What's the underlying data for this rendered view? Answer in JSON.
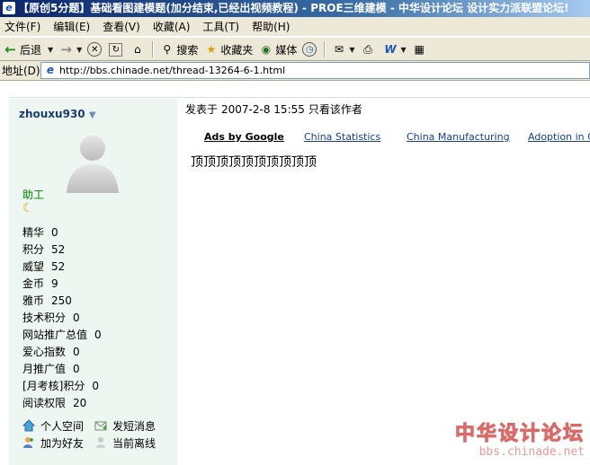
{
  "window": {
    "title": "【原创5分题】基础看图建模题(加分结束,已经出视频教程) - PROE三维建模 - 中华设计论坛 设计实力派联盟论坛!"
  },
  "menu": [
    "文件(F)",
    "编辑(E)",
    "查看(V)",
    "收藏(A)",
    "工具(T)",
    "帮助(H)"
  ],
  "toolbar": {
    "back_label": "后退",
    "search_label": "搜索",
    "favorites_label": "收藏夹",
    "media_label": "媒体"
  },
  "address": {
    "label": "地址(D)",
    "url": "http://bbs.chinade.net/thread-13264-6-1.html"
  },
  "user": {
    "name": "zhouxu930",
    "rank": "助工",
    "stats": [
      {
        "label": "精华",
        "value": "0"
      },
      {
        "label": "积分",
        "value": "52"
      },
      {
        "label": "威望",
        "value": "52"
      },
      {
        "label": "金币",
        "value": "9"
      },
      {
        "label": "雅币",
        "value": "250"
      },
      {
        "label": "技术积分",
        "value": "0"
      },
      {
        "label": "网站推广总值",
        "value": "0"
      },
      {
        "label": "爱心指数",
        "value": "0"
      },
      {
        "label": "月推广值",
        "value": "0"
      },
      {
        "label": "[月考核]积分",
        "value": "0"
      },
      {
        "label": "阅读权限",
        "value": "20"
      }
    ],
    "actions": {
      "space": "个人空间",
      "message": "发短消息",
      "add_friend": "加为好友",
      "status": "当前离线"
    }
  },
  "post": {
    "posted_label": "发表于",
    "date": "2007-2-8 15:55",
    "only_author": "只看该作者",
    "ads_title": "Ads by Google",
    "ads": [
      "China Statistics",
      "China Manufacturing",
      "Adoption in China"
    ],
    "message": "顶顶顶顶顶顶顶顶顶顶"
  },
  "watermark": {
    "line1": "中华设计论坛",
    "line2": "bbs.chinade.net"
  }
}
